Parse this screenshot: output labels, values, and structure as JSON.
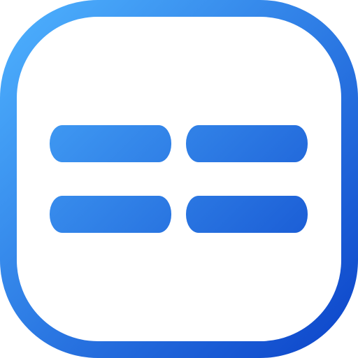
{
  "icon": {
    "name": "grid-split-icon",
    "gradient": {
      "start": "#4fb3ff",
      "end": "#0b43c9"
    },
    "background": "#ffffff"
  }
}
